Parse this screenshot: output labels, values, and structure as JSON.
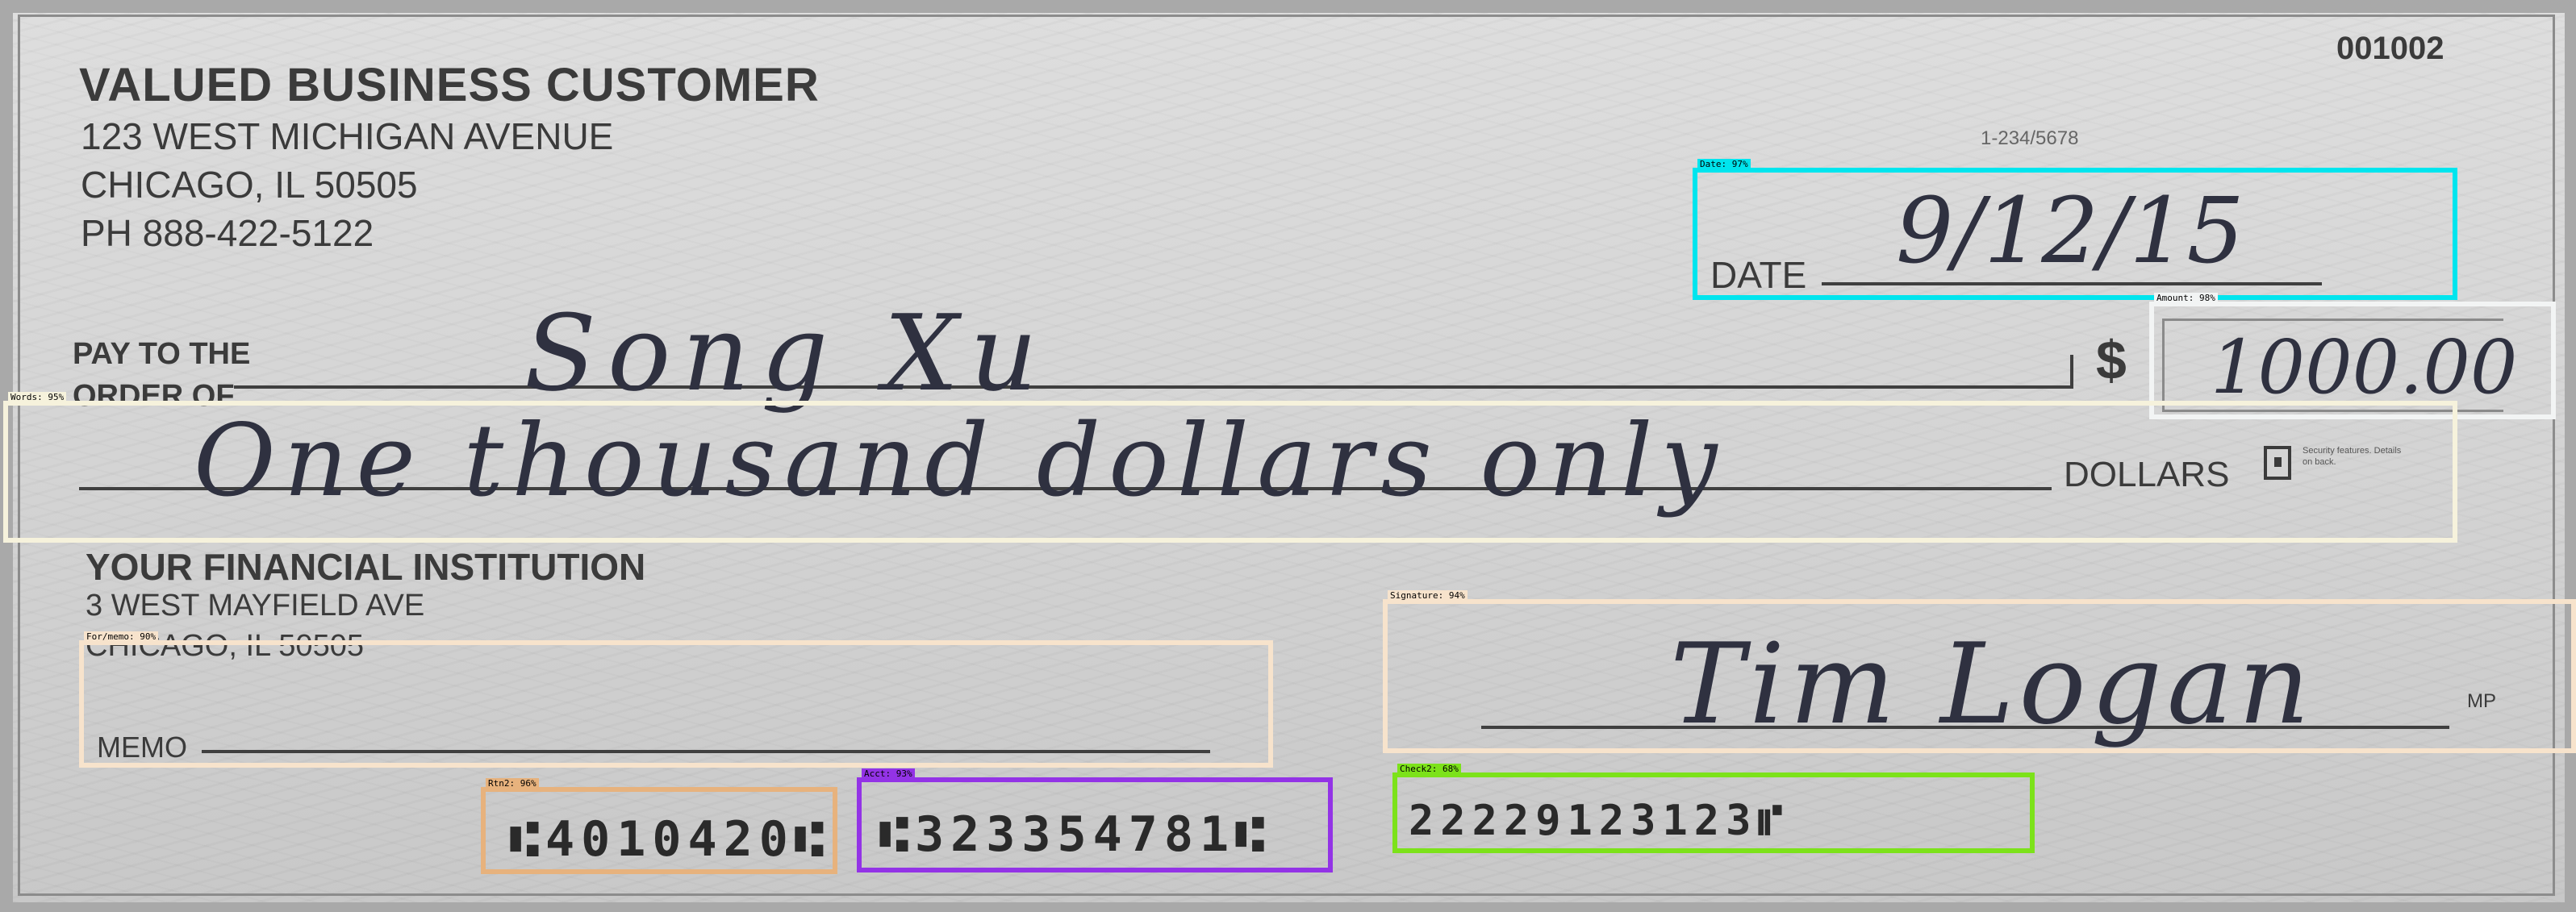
{
  "check": {
    "number": "001002",
    "payer": {
      "name": "VALUED BUSINESS CUSTOMER",
      "address1": "123 WEST MICHIGAN AVENUE",
      "address2": "CHICAGO, IL 50505",
      "phone": "PH 888-422-5122"
    },
    "fraction_code": "1-234/5678",
    "date_label": "DATE",
    "date_value": "9/12/15",
    "pay_to_label_line1": "PAY TO THE",
    "pay_to_label_line2": "ORDER OF",
    "payee": "Song Xu",
    "dollar_sign": "$",
    "amount": "1000.00",
    "amount_words": "One thousand dollars only",
    "dollars_label": "DOLLARS",
    "security_text": "Security features. Details on back.",
    "bank": {
      "name": "YOUR FINANCIAL INSTITUTION",
      "address1": "3 WEST MAYFIELD AVE",
      "address2": "CHICAGO, IL 50505"
    },
    "memo_label": "MEMO",
    "signature": "Tim Logan",
    "signature_mark": "MP",
    "micr": {
      "routing": "⑆4010420⑆",
      "account": "⑆323354781⑆",
      "check": "22229123123⑈"
    }
  },
  "detections": [
    {
      "label": "Date: 97%",
      "color": "#00e5ee"
    },
    {
      "label": "Amount: 98%",
      "color": "#f2f4f4"
    },
    {
      "label": "Words: 95%",
      "color": "#f6f2dc"
    },
    {
      "label": "Signature: 94%",
      "color": "#f7e3cc"
    },
    {
      "label": "For/memo: 90%",
      "color": "#f7e3cc"
    },
    {
      "label": "Rtn2: 96%",
      "color": "#e7b27d"
    },
    {
      "label": "Acct: 93%",
      "color": "#9333e6"
    },
    {
      "label": "Check2: 68%",
      "color": "#7ce21a"
    }
  ]
}
